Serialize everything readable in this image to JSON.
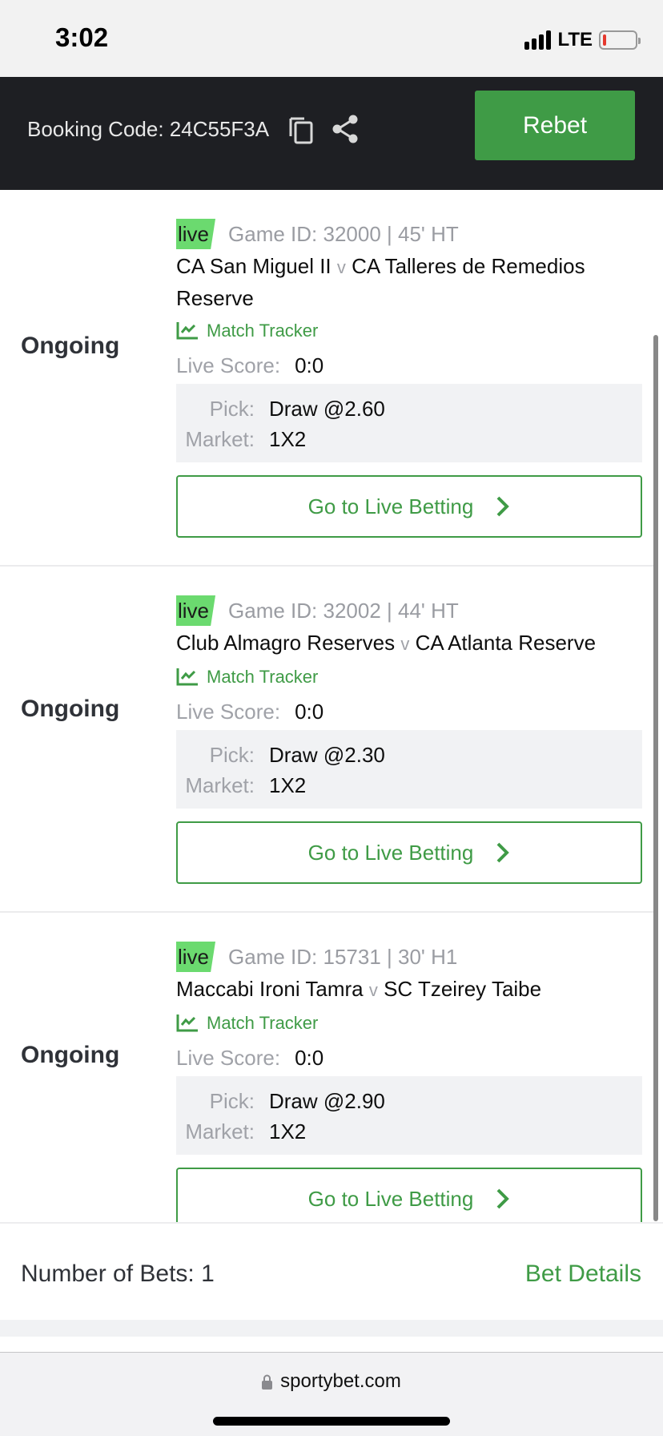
{
  "status_bar": {
    "time": "3:02",
    "network": "LTE",
    "battery_level": "low"
  },
  "header": {
    "booking_code_label": "Booking Code: 24C55F3A",
    "copy_icon": "copy-icon",
    "share_icon": "share-icon",
    "rebet_label": "Rebet"
  },
  "matches": [
    {
      "status": "Ongoing",
      "live_label": "live",
      "game_info": "Game ID: 32000 | 45' HT",
      "home": "CA San Miguel II",
      "vs": "v",
      "away": "CA Talleres de Remedios Reserve",
      "tracker_label": "Match Tracker",
      "score_label": "Live Score:",
      "score": "0:0",
      "pick_label": "Pick:",
      "pick": "Draw @2.60",
      "market_label": "Market:",
      "market": "1X2",
      "button_label": "Go to Live Betting"
    },
    {
      "status": "Ongoing",
      "live_label": "live",
      "game_info": "Game ID: 32002 | 44' HT",
      "home": "Club Almagro Reserves",
      "vs": "v",
      "away": "CA Atlanta Reserve",
      "tracker_label": "Match Tracker",
      "score_label": "Live Score:",
      "score": "0:0",
      "pick_label": "Pick:",
      "pick": "Draw @2.30",
      "market_label": "Market:",
      "market": "1X2",
      "button_label": "Go to Live Betting"
    },
    {
      "status": "Ongoing",
      "live_label": "live",
      "game_info": "Game ID: 15731 | 30' H1",
      "home": "Maccabi Ironi Tamra",
      "vs": "v",
      "away": "SC Tzeirey Taibe",
      "tracker_label": "Match Tracker",
      "score_label": "Live Score:",
      "score": "0:0",
      "pick_label": "Pick:",
      "pick": "Draw @2.90",
      "market_label": "Market:",
      "market": "1X2",
      "button_label": "Go to Live Betting"
    }
  ],
  "summary": {
    "number_of_bets": "Number of Bets: 1",
    "bet_details_label": "Bet Details"
  },
  "browser": {
    "url": "sportybet.com"
  },
  "colors": {
    "accent_green": "#3f9b46",
    "live_tag": "#6bda6f",
    "header_bg": "#1e1f23"
  }
}
